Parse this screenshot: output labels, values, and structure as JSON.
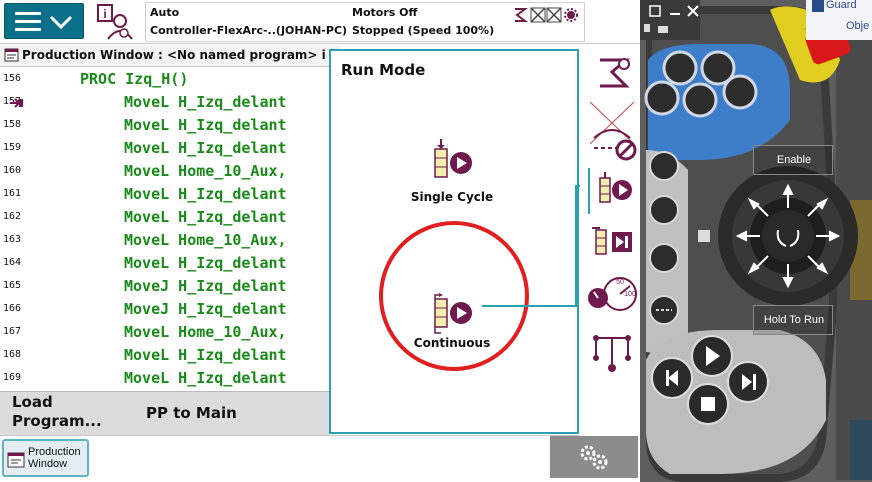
{
  "topbar": {
    "mode": "Auto",
    "controller": "Controller-FlexArc-..(JOHAN-PC)",
    "motors": "Motors Off",
    "state": "Stopped (Speed 100%)"
  },
  "tab": {
    "title": "Production Window : <No named program> i"
  },
  "code": {
    "lines": [
      {
        "num": "156",
        "text": "PROC Izq_H()"
      },
      {
        "num": "157",
        "text": "MoveL H_Izq_delant"
      },
      {
        "num": "158",
        "text": "MoveL H_Izq_delant"
      },
      {
        "num": "159",
        "text": "MoveL H_Izq_delant"
      },
      {
        "num": "160",
        "text": "MoveL Home_10_Aux,"
      },
      {
        "num": "161",
        "text": "MoveL H_Izq_delant"
      },
      {
        "num": "162",
        "text": "MoveL H_Izq_delant"
      },
      {
        "num": "163",
        "text": "MoveL Home_10_Aux,"
      },
      {
        "num": "164",
        "text": "MoveL H_Izq_delant"
      },
      {
        "num": "165",
        "text": "MoveJ H_Izq_delant"
      },
      {
        "num": "166",
        "text": "MoveJ H_Izq_delant"
      },
      {
        "num": "167",
        "text": "MoveL Home_10_Aux,"
      },
      {
        "num": "168",
        "text": "MoveL H_Izq_delant"
      },
      {
        "num": "169",
        "text": "MoveL H_Izq_delant"
      }
    ]
  },
  "bottombar": {
    "load_line1": "Load",
    "load_line2": "Program...",
    "pp_to_main": "PP to Main"
  },
  "taskbar": {
    "production_line1": "Production",
    "production_line2": "Window"
  },
  "runmode": {
    "title": "Run Mode",
    "single_cycle": "Single Cycle",
    "continuous": "Continuous"
  },
  "hardware": {
    "enable": "Enable",
    "hold_to_run": "Hold To Run",
    "guard_fragment": "Guard",
    "ob_fragment": "Obje"
  },
  "colors": {
    "accent": "#0a6f88",
    "code_green": "#1a8a1a",
    "run_icon": "#6e1a4c",
    "highlight_ring": "#e02020",
    "popup_border": "#2aa0b0"
  }
}
